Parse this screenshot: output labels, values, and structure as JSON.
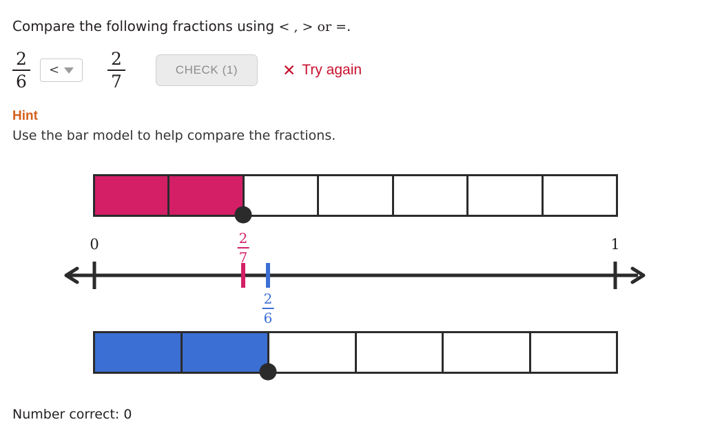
{
  "prompt": {
    "text_before": "Compare the following fractions using ",
    "symbols": "< , > or =",
    "text_after": "."
  },
  "answer_row": {
    "left_fraction": {
      "numerator": "2",
      "denominator": "6"
    },
    "dropdown": {
      "selected": "<",
      "options": [
        "<",
        ">",
        "="
      ],
      "caret_icon": "chevron-down-icon"
    },
    "right_fraction": {
      "numerator": "2",
      "denominator": "7"
    },
    "check_button": {
      "label": "CHECK (1)"
    },
    "feedback": {
      "icon": "x-mark-icon",
      "icon_glyph": "✕",
      "text": "Try again",
      "color": "#c8102e"
    }
  },
  "hint": {
    "title": "Hint",
    "title_color": "#d4601c",
    "text": "Use the bar model to help compare the fractions."
  },
  "chart_data": {
    "type": "bar",
    "title": "Fraction comparison bar models and number line",
    "models": [
      {
        "name": "top-bar-model",
        "fraction": "2/7",
        "numerator": 2,
        "denominator": 7,
        "value": 0.2857,
        "fill_color": "#d41f67",
        "marker_segment": 2
      },
      {
        "name": "bottom-bar-model",
        "fraction": "2/6",
        "numerator": 2,
        "denominator": 6,
        "value": 0.3333,
        "fill_color": "#3b6fd4",
        "marker_segment": 2
      }
    ],
    "number_line": {
      "min_label": "0",
      "max_label": "1",
      "min_value": 0,
      "max_value": 1,
      "marks": [
        {
          "name": "mark-two-sevenths",
          "numerator": "2",
          "denominator": "7",
          "value": 0.2857,
          "color": "#d41f67",
          "label_position": "above"
        },
        {
          "name": "mark-two-sixths",
          "numerator": "2",
          "denominator": "6",
          "value": 0.3333,
          "color": "#3b6fd4",
          "label_position": "below"
        }
      ]
    }
  },
  "footer": {
    "score_text": "Number correct: 0"
  }
}
